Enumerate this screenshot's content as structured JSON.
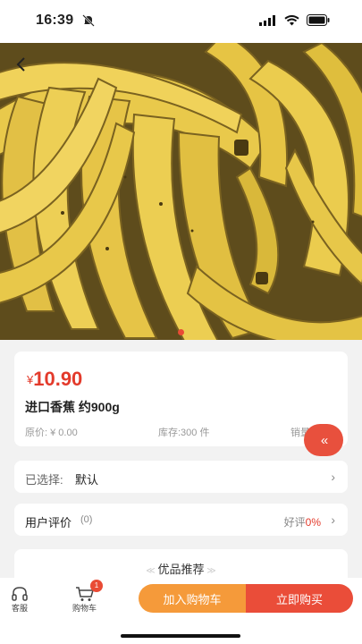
{
  "status": {
    "time": "16:39"
  },
  "product": {
    "currency": "¥",
    "price": "10.90",
    "name": "进口香蕉 约900g",
    "original_price": "原价: ¥ 0.00",
    "stock": "库存:300 件",
    "sales": "销量"
  },
  "fab": {
    "label": "«"
  },
  "selection": {
    "label": "已选择:",
    "value": "默认"
  },
  "reviews": {
    "label": "用户评价",
    "count": "(0)",
    "rate_label": "好评",
    "rate_value": "0%"
  },
  "recommend": {
    "title": "优品推荐"
  },
  "tabbar": {
    "service": "客服",
    "cart": "购物车",
    "cart_badge": "1",
    "add_to_cart": "加入购物车",
    "buy_now": "立即购买"
  },
  "colors": {
    "accent": "#e94b35",
    "orange": "#f59a3a",
    "banana": "#e8c640"
  },
  "hero": {
    "icon": "banana-photo",
    "carousel_index": 1
  }
}
